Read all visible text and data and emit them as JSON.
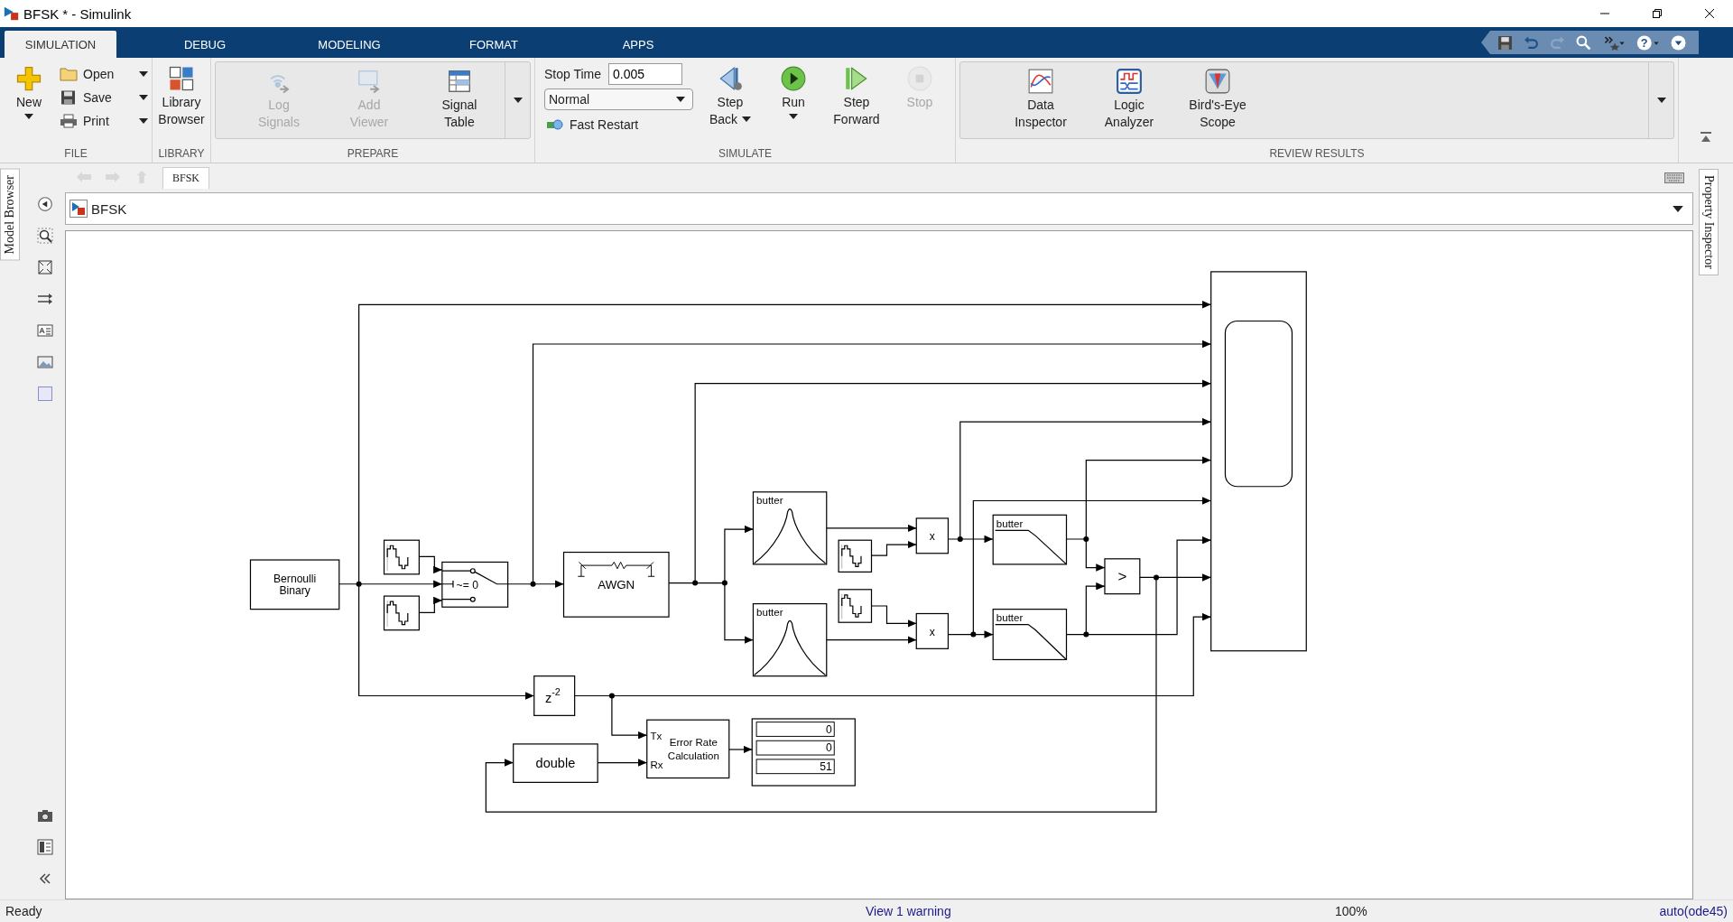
{
  "window": {
    "title": "BFSK * - Simulink"
  },
  "tabs": [
    {
      "label": "SIMULATION",
      "selected": true
    },
    {
      "label": "DEBUG",
      "selected": false
    },
    {
      "label": "MODELING",
      "selected": false
    },
    {
      "label": "FORMAT",
      "selected": false
    },
    {
      "label": "APPS",
      "selected": false
    }
  ],
  "quick_access": {
    "help": "?"
  },
  "ribbon": {
    "file": {
      "title": "FILE",
      "new": "New",
      "items": [
        {
          "label": "Open"
        },
        {
          "label": "Save"
        },
        {
          "label": "Print"
        }
      ]
    },
    "library": {
      "title": "LIBRARY",
      "lines": [
        "Library",
        "Browser"
      ]
    },
    "prepare": {
      "title": "PREPARE",
      "buttons": [
        {
          "lines": [
            "Log",
            "Signals"
          ],
          "disabled": true
        },
        {
          "lines": [
            "Add",
            "Viewer"
          ],
          "disabled": true
        },
        {
          "lines": [
            "Signal",
            "Table"
          ],
          "disabled": false
        }
      ]
    },
    "simulate": {
      "title": "SIMULATE",
      "stop_time_label": "Stop Time",
      "stop_time": "0.005",
      "mode": "Normal",
      "fast_restart": "Fast Restart",
      "buttons": [
        {
          "lines": [
            "Step",
            "Back"
          ],
          "menu": true,
          "disabled": false
        },
        {
          "lines": [
            "Run"
          ],
          "menu": true,
          "disabled": false
        },
        {
          "lines": [
            "Step",
            "Forward"
          ],
          "menu": false,
          "disabled": false
        },
        {
          "lines": [
            "Stop"
          ],
          "menu": false,
          "disabled": true
        }
      ]
    },
    "review": {
      "title": "REVIEW RESULTS",
      "buttons": [
        {
          "lines": [
            "Data",
            "Inspector"
          ]
        },
        {
          "lines": [
            "Logic",
            "Analyzer"
          ]
        },
        {
          "lines": [
            "Bird's-Eye",
            "Scope"
          ]
        }
      ]
    }
  },
  "breadcrumb": {
    "tab": "BFSK"
  },
  "address": {
    "path": "BFSK"
  },
  "side_panels": {
    "left": "Model Browser",
    "right": "Property Inspector"
  },
  "diagram": {
    "blocks": [
      {
        "kind": "source",
        "lines": [
          "Bernoulli",
          "Binary"
        ]
      },
      {
        "kind": "sine"
      },
      {
        "kind": "sine"
      },
      {
        "kind": "switch",
        "text": "~= 0"
      },
      {
        "kind": "awgn",
        "text": "AWGN"
      },
      {
        "kind": "bandpass",
        "text": "butter"
      },
      {
        "kind": "bandpass",
        "text": "butter"
      },
      {
        "kind": "sine"
      },
      {
        "kind": "sine"
      },
      {
        "kind": "product",
        "text": "x"
      },
      {
        "kind": "product",
        "text": "x"
      },
      {
        "kind": "lowpass",
        "text": "butter"
      },
      {
        "kind": "lowpass",
        "text": "butter"
      },
      {
        "kind": "relational",
        "text": ">"
      },
      {
        "kind": "scope"
      },
      {
        "kind": "delay",
        "text": "z",
        "superscript": "-2"
      },
      {
        "kind": "convert",
        "text": "double"
      },
      {
        "kind": "error_rate",
        "ports": [
          "Tx",
          "Rx"
        ],
        "lines": [
          "Error Rate",
          "Calculation"
        ]
      },
      {
        "kind": "display",
        "values": [
          "0",
          "0",
          "51"
        ]
      }
    ]
  },
  "status_bar": {
    "state": "Ready",
    "warning": "View 1 warning",
    "zoom": "100%",
    "solver": "auto(ode45)"
  }
}
